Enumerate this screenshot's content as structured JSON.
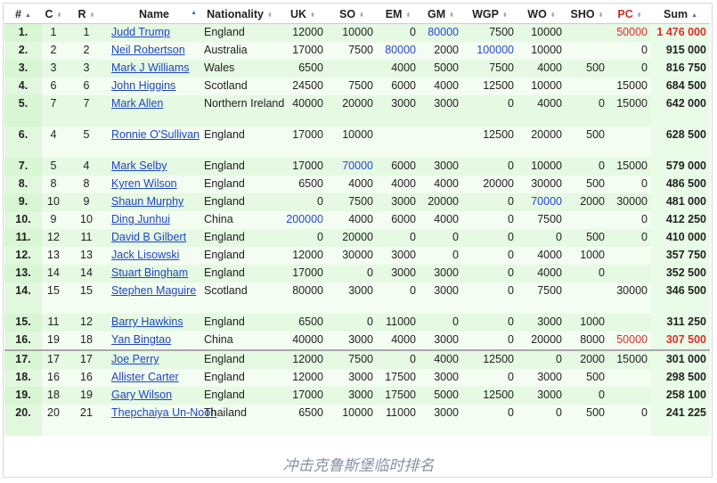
{
  "headers": [
    "#",
    "C",
    "R",
    "Name",
    "Nationality",
    "UK",
    "SO",
    "EM",
    "GM",
    "WGP",
    "WO",
    "SHO",
    "PC",
    "Sum"
  ],
  "caption": "冲击克鲁斯堡临时排名",
  "colors": {
    "link": "#1f45c4",
    "highlight_blue": "#2547d8",
    "highlight_red": "#dc2d2d",
    "row_alt": "#e5f9e3"
  },
  "rows": [
    {
      "n": "1.",
      "c": "1",
      "r": "1",
      "name": "Judd Trump",
      "nat": "England",
      "uk": "12000",
      "so": "10000",
      "em": "0",
      "gm": "80000",
      "wgp": "7500",
      "wo": "10000",
      "sho": "",
      "pc": "50000",
      "sum": "1 476 000"
    },
    {
      "n": "2.",
      "c": "2",
      "r": "2",
      "name": "Neil Robertson",
      "nat": "Australia",
      "uk": "17000",
      "so": "7500",
      "em": "80000",
      "gm": "2000",
      "wgp": "100000",
      "wo": "10000",
      "sho": "",
      "pc": "0",
      "sum": "915 000"
    },
    {
      "n": "3.",
      "c": "3",
      "r": "3",
      "name": "Mark J Williams",
      "nat": "Wales",
      "uk": "6500",
      "so": "",
      "em": "4000",
      "gm": "5000",
      "wgp": "7500",
      "wo": "4000",
      "sho": "500",
      "pc": "0",
      "sum": "816 750"
    },
    {
      "n": "4.",
      "c": "6",
      "r": "6",
      "name": "John Higgins",
      "nat": "Scotland",
      "uk": "24500",
      "so": "7500",
      "em": "6000",
      "gm": "4000",
      "wgp": "12500",
      "wo": "10000",
      "sho": "",
      "pc": "15000",
      "sum": "684 500"
    },
    {
      "n": "5.",
      "c": "7",
      "r": "7",
      "name": "Mark Allen",
      "nat": "Northern Ireland",
      "uk": "40000",
      "so": "20000",
      "em": "3000",
      "gm": "3000",
      "wgp": "0",
      "wo": "4000",
      "sho": "0",
      "pc": "15000",
      "sum": "642 000"
    },
    {
      "n": "6.",
      "c": "4",
      "r": "5",
      "name": "Ronnie O'Sullivan",
      "nat": "England",
      "uk": "17000",
      "so": "10000",
      "em": "",
      "gm": "",
      "wgp": "12500",
      "wo": "20000",
      "sho": "500",
      "pc": "",
      "sum": "628 500"
    },
    {
      "n": "7.",
      "c": "5",
      "r": "4",
      "name": "Mark Selby",
      "nat": "England",
      "uk": "17000",
      "so": "70000",
      "em": "6000",
      "gm": "3000",
      "wgp": "0",
      "wo": "10000",
      "sho": "0",
      "pc": "15000",
      "sum": "579 000"
    },
    {
      "n": "8.",
      "c": "8",
      "r": "8",
      "name": "Kyren Wilson",
      "nat": "England",
      "uk": "6500",
      "so": "4000",
      "em": "4000",
      "gm": "4000",
      "wgp": "20000",
      "wo": "30000",
      "sho": "500",
      "pc": "0",
      "sum": "486 500"
    },
    {
      "n": "9.",
      "c": "10",
      "r": "9",
      "name": "Shaun Murphy",
      "nat": "England",
      "uk": "0",
      "so": "7500",
      "em": "3000",
      "gm": "20000",
      "wgp": "0",
      "wo": "70000",
      "sho": "2000",
      "pc": "30000",
      "sum": "481 000"
    },
    {
      "n": "10.",
      "c": "9",
      "r": "10",
      "name": "Ding Junhui",
      "nat": "China",
      "uk": "200000",
      "so": "4000",
      "em": "6000",
      "gm": "4000",
      "wgp": "0",
      "wo": "7500",
      "sho": "",
      "pc": "0",
      "sum": "412 250"
    },
    {
      "n": "11.",
      "c": "12",
      "r": "11",
      "name": "David B Gilbert",
      "nat": "England",
      "uk": "0",
      "so": "20000",
      "em": "0",
      "gm": "0",
      "wgp": "0",
      "wo": "0",
      "sho": "500",
      "pc": "0",
      "sum": "410 000"
    },
    {
      "n": "12.",
      "c": "13",
      "r": "13",
      "name": "Jack Lisowski",
      "nat": "England",
      "uk": "12000",
      "so": "30000",
      "em": "3000",
      "gm": "0",
      "wgp": "0",
      "wo": "4000",
      "sho": "1000",
      "pc": "",
      "sum": "357 750"
    },
    {
      "n": "13.",
      "c": "14",
      "r": "14",
      "name": "Stuart Bingham",
      "nat": "England",
      "uk": "17000",
      "so": "0",
      "em": "3000",
      "gm": "3000",
      "wgp": "0",
      "wo": "4000",
      "sho": "0",
      "pc": "",
      "sum": "352 500"
    },
    {
      "n": "14.",
      "c": "15",
      "r": "15",
      "name": "Stephen Maguire",
      "nat": "Scotland",
      "uk": "80000",
      "so": "3000",
      "em": "0",
      "gm": "3000",
      "wgp": "0",
      "wo": "7500",
      "sho": "",
      "pc": "30000",
      "sum": "346 500"
    },
    {
      "n": "15.",
      "c": "11",
      "r": "12",
      "name": "Barry Hawkins",
      "nat": "England",
      "uk": "6500",
      "so": "0",
      "em": "11000",
      "gm": "0",
      "wgp": "0",
      "wo": "3000",
      "sho": "1000",
      "pc": "",
      "sum": "311 250"
    },
    {
      "n": "16.",
      "c": "19",
      "r": "18",
      "name": "Yan Bingtao",
      "nat": "China",
      "uk": "40000",
      "so": "3000",
      "em": "4000",
      "gm": "3000",
      "wgp": "0",
      "wo": "20000",
      "sho": "8000",
      "pc": "50000",
      "sum": "307 500"
    },
    {
      "n": "17.",
      "c": "17",
      "r": "17",
      "name": "Joe Perry",
      "nat": "England",
      "uk": "12000",
      "so": "7500",
      "em": "0",
      "gm": "4000",
      "wgp": "12500",
      "wo": "0",
      "sho": "2000",
      "pc": "15000",
      "sum": "301 000"
    },
    {
      "n": "18.",
      "c": "16",
      "r": "16",
      "name": "Allister Carter",
      "nat": "England",
      "uk": "12000",
      "so": "3000",
      "em": "17500",
      "gm": "3000",
      "wgp": "0",
      "wo": "3000",
      "sho": "500",
      "pc": "",
      "sum": "298 500"
    },
    {
      "n": "19.",
      "c": "18",
      "r": "19",
      "name": "Gary Wilson",
      "nat": "England",
      "uk": "17000",
      "so": "3000",
      "em": "17500",
      "gm": "5000",
      "wgp": "12500",
      "wo": "3000",
      "sho": "0",
      "pc": "",
      "sum": "258 100"
    },
    {
      "n": "20.",
      "c": "20",
      "r": "21",
      "name": "Thepchaiya Un-Nooh",
      "nat": "Thailand",
      "uk": "6500",
      "so": "10000",
      "em": "11000",
      "gm": "3000",
      "wgp": "0",
      "wo": "0",
      "sho": "500",
      "pc": "0",
      "sum": "241 225"
    }
  ]
}
